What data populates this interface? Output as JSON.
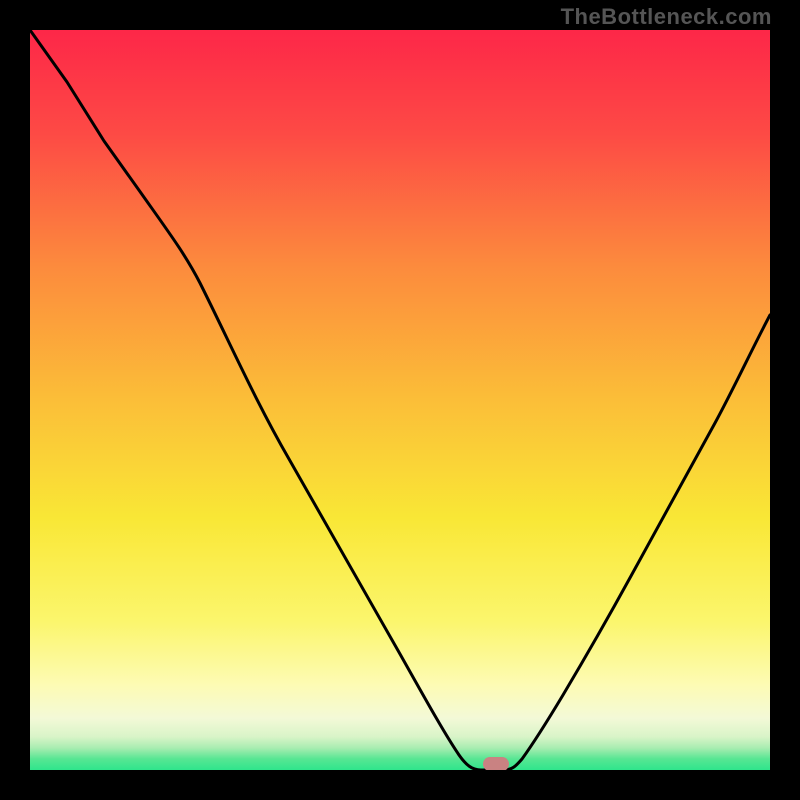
{
  "branding": "TheBottleneck.com",
  "chart_data": {
    "type": "line",
    "title": "",
    "xlabel": "",
    "ylabel": "",
    "xlim": [
      0,
      100
    ],
    "ylim": [
      0,
      100
    ],
    "x": [
      0,
      5,
      10,
      15,
      20,
      25,
      30,
      35,
      40,
      45,
      50,
      55,
      58,
      60,
      62,
      64,
      66,
      70,
      75,
      80,
      85,
      90,
      95,
      100
    ],
    "values": [
      100,
      93,
      85,
      78,
      71,
      65,
      56,
      47,
      38,
      29,
      20,
      11,
      4,
      1,
      0,
      0,
      1,
      5,
      12,
      21,
      31,
      42,
      53,
      65
    ],
    "marker": {
      "x": 63,
      "y": 0
    },
    "background": {
      "top": "#fd2748",
      "mid1": "#fc9a3a",
      "mid2": "#f9e736",
      "mid3": "#fdfbb4",
      "bottom_band": "#f2f9da",
      "green": "#2fe58c"
    }
  }
}
